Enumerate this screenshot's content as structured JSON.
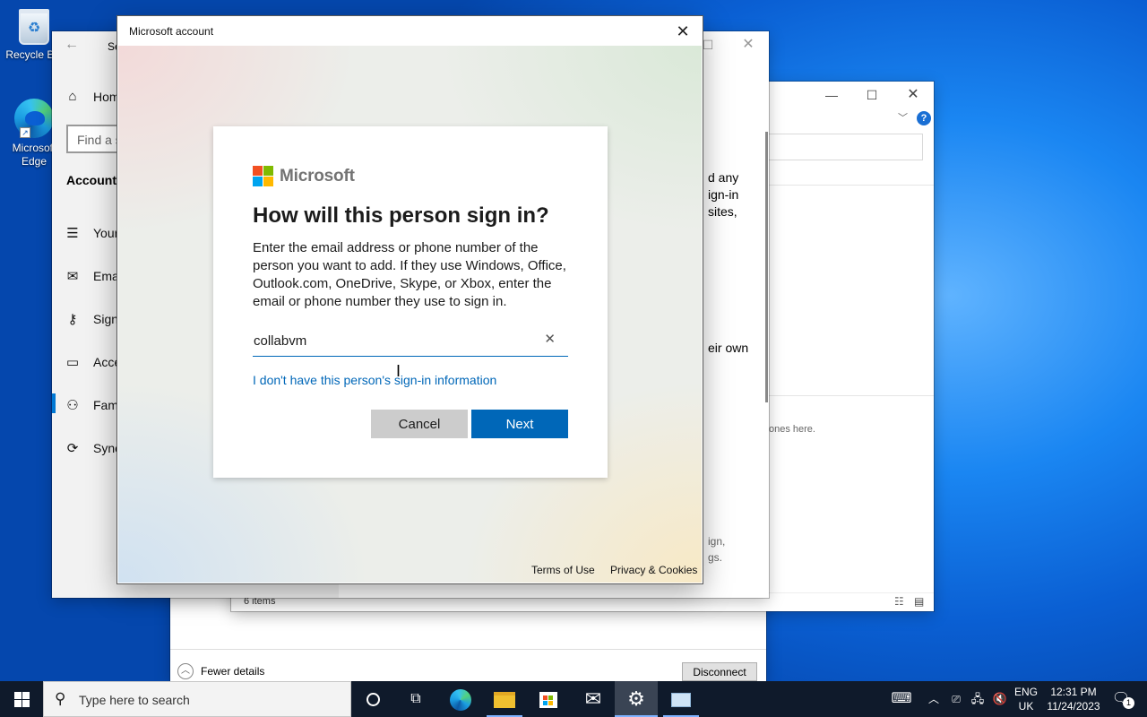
{
  "desktop": {
    "icons": [
      {
        "label": "Recycle Bin",
        "icon": "recycle-bin-icon"
      },
      {
        "label": "Microsoft Edge",
        "icon": "edge-icon"
      }
    ]
  },
  "settings_window": {
    "title_partial": "Se",
    "home_label": "Hom",
    "search_placeholder": "Find a s",
    "section_heading": "Accounts",
    "nav_items": [
      {
        "label": "Your",
        "icon": "person-list-icon"
      },
      {
        "label": "Ema",
        "icon": "mail-icon"
      },
      {
        "label": "Sign",
        "icon": "key-icon"
      },
      {
        "label": "Acce",
        "icon": "briefcase-icon"
      },
      {
        "label": "Fami",
        "icon": "people-icon"
      },
      {
        "label": "Sync",
        "icon": "sync-icon"
      }
    ],
    "body_fragments": [
      "d any",
      "ign-in",
      "sites,",
      "eir own",
      "ign,",
      "gs."
    ]
  },
  "explorer_window": {
    "status_items": "6 items",
    "hint_text": "ones here."
  },
  "task_manager_window": {
    "fewer_details": "Fewer details",
    "disconnect": "Disconnect"
  },
  "dialog": {
    "title": "Microsoft account",
    "brand": "Microsoft",
    "brand_colors": [
      "#f25022",
      "#7fba00",
      "#00a4ef",
      "#ffb900"
    ],
    "heading": "How will this person sign in?",
    "description": "Enter the email address or phone number of the person you want to add. If they use Windows, Office, Outlook.com, OneDrive, Skype, or Xbox, enter the email or phone number they use to sign in.",
    "input_value": "collabvm",
    "no_info_link": "I don't have this person's sign-in information",
    "cancel_label": "Cancel",
    "next_label": "Next",
    "terms_label": "Terms of Use",
    "privacy_label": "Privacy & Cookies",
    "accent_color": "#0067b8"
  },
  "taskbar": {
    "search_placeholder": "Type here to search",
    "language_line1": "ENG",
    "language_line2": "UK",
    "time": "12:31 PM",
    "date": "11/24/2023",
    "notification_count": "1"
  }
}
